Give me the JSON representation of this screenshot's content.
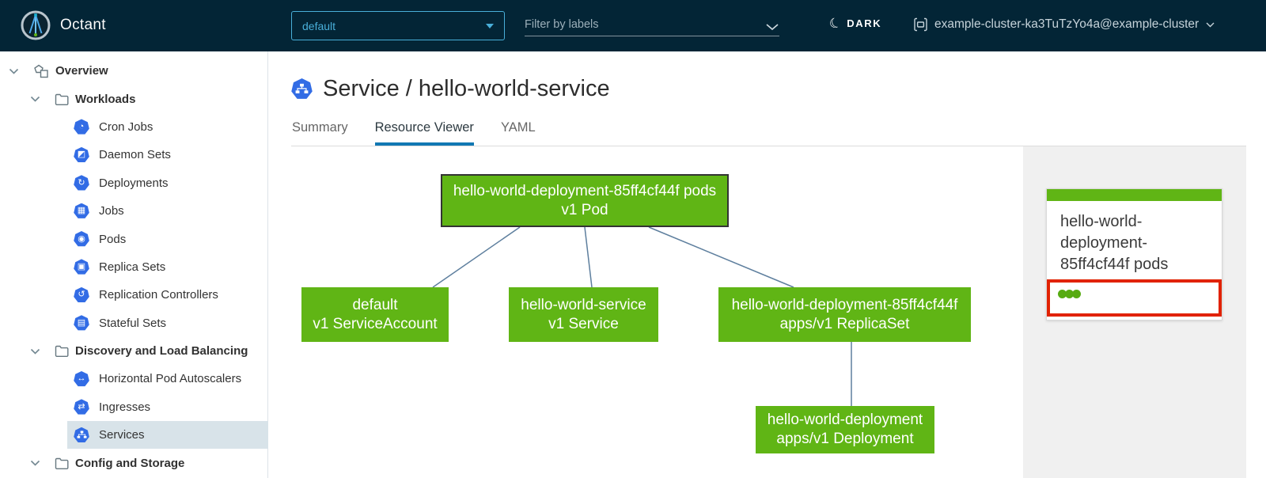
{
  "header": {
    "app_title": "Octant",
    "namespace": {
      "value": "default"
    },
    "filter": {
      "placeholder": "Filter by labels"
    },
    "theme_toggle": {
      "label": "DARK"
    },
    "context": {
      "value": "example-cluster-ka3TuTzYo4a@example-cluster"
    }
  },
  "sidebar": {
    "items": [
      {
        "type": "group",
        "level": 0,
        "label": "Overview",
        "icon": "overview-icon",
        "expanded": true
      },
      {
        "type": "group",
        "level": 1,
        "label": "Workloads",
        "icon": "folder-icon",
        "expanded": true
      },
      {
        "type": "leaf",
        "label": "Cron Jobs",
        "icon": "cron-jobs-icon",
        "glyph": "◔"
      },
      {
        "type": "leaf",
        "label": "Daemon Sets",
        "icon": "daemon-sets-icon",
        "glyph": "◩"
      },
      {
        "type": "leaf",
        "label": "Deployments",
        "icon": "deployments-icon",
        "glyph": "↻"
      },
      {
        "type": "leaf",
        "label": "Jobs",
        "icon": "jobs-icon",
        "glyph": "▦"
      },
      {
        "type": "leaf",
        "label": "Pods",
        "icon": "pods-icon",
        "glyph": "◉"
      },
      {
        "type": "leaf",
        "label": "Replica Sets",
        "icon": "replica-sets-icon",
        "glyph": "▣"
      },
      {
        "type": "leaf",
        "label": "Replication Controllers",
        "icon": "replication-controllers-icon",
        "glyph": "↺"
      },
      {
        "type": "leaf",
        "label": "Stateful Sets",
        "icon": "stateful-sets-icon",
        "glyph": "▤"
      },
      {
        "type": "group",
        "level": 1,
        "label": "Discovery and Load Balancing",
        "icon": "folder-icon",
        "expanded": true
      },
      {
        "type": "leaf",
        "label": "Horizontal Pod Autoscalers",
        "icon": "hpa-icon",
        "glyph": "↔"
      },
      {
        "type": "leaf",
        "label": "Ingresses",
        "icon": "ingresses-icon",
        "glyph": "⇄"
      },
      {
        "type": "leaf",
        "label": "Services",
        "icon": "services-icon",
        "selected": true
      },
      {
        "type": "group",
        "level": 1,
        "label": "Config and Storage",
        "icon": "folder-icon",
        "expanded": true
      }
    ]
  },
  "main": {
    "title": "Service / hello-world-service",
    "title_icon": "service-icon",
    "tabs": [
      {
        "label": "Summary",
        "active": false
      },
      {
        "label": "Resource Viewer",
        "active": true
      },
      {
        "label": "YAML",
        "active": false
      }
    ]
  },
  "graph": {
    "nodes": [
      {
        "id": "pod",
        "selected": true,
        "lines": [
          "hello-world-deployment-85ff4cf44f pods",
          "v1 Pod"
        ]
      },
      {
        "id": "serviceaccount",
        "lines": [
          "default",
          "v1 ServiceAccount"
        ]
      },
      {
        "id": "service",
        "lines": [
          "hello-world-service",
          "v1 Service"
        ]
      },
      {
        "id": "replicaset",
        "lines": [
          "hello-world-deployment-85ff4cf44f",
          "apps/v1 ReplicaSet"
        ]
      },
      {
        "id": "deployment",
        "lines": [
          "hello-world-deployment",
          "apps/v1 Deployment"
        ]
      }
    ],
    "edges": [
      {
        "from": "pod",
        "to": "serviceaccount"
      },
      {
        "from": "pod",
        "to": "service"
      },
      {
        "from": "pod",
        "to": "replicaset"
      },
      {
        "from": "replicaset",
        "to": "deployment"
      }
    ]
  },
  "side_panel": {
    "card": {
      "title": "hello-world-deployment-85ff4cf44f pods",
      "status_dot_count": 3
    }
  },
  "colors": {
    "header_bg": "#032536",
    "accent_blue": "#49afd9",
    "k8s_icon_blue": "#326ce5",
    "node_green": "#60b515",
    "tab_underline": "#1278b3",
    "selected_row_bg": "#d8e3e9",
    "annotation_red": "#e12200",
    "edge_color": "#5e7f9e"
  }
}
